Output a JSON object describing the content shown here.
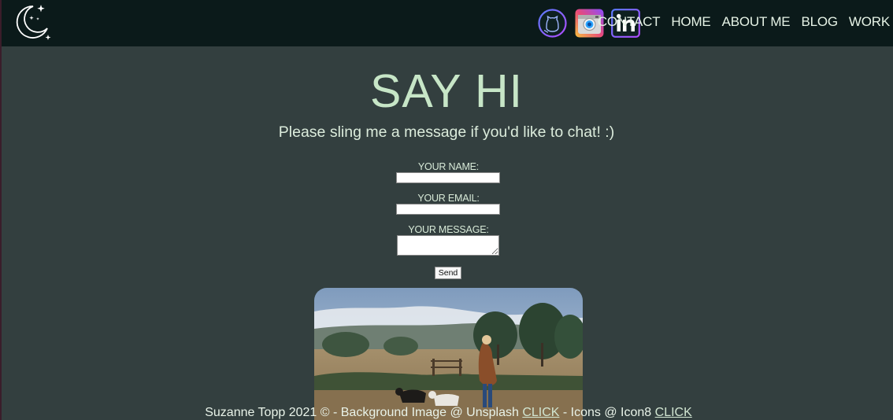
{
  "nav": {
    "links": [
      "CONTACT",
      "HOME",
      "ABOUT ME",
      "BLOG",
      "WORK"
    ],
    "social_icons": [
      "github-icon",
      "instagram-icon",
      "linkedin-icon"
    ]
  },
  "main": {
    "title": "SAY HI",
    "subtitle": "Please sling me a message if you'd like to chat! :)",
    "form": {
      "name_label": "YOUR NAME:",
      "name_value": "",
      "email_label": "YOUR EMAIL:",
      "email_value": "",
      "message_label": "YOUR MESSAGE:",
      "message_value": "",
      "send_label": "Send"
    }
  },
  "footer": {
    "text1": "Suzanne Topp 2021 © - Background Image @ Unsplash ",
    "link1": "CLICK",
    "text2": " - Icons @ Icon8 ",
    "link2": "CLICK"
  },
  "colors": {
    "background": "#333f3f",
    "navbar": "#0b1a1a",
    "title": "#c7e6c7",
    "text": "#d8ead8"
  }
}
